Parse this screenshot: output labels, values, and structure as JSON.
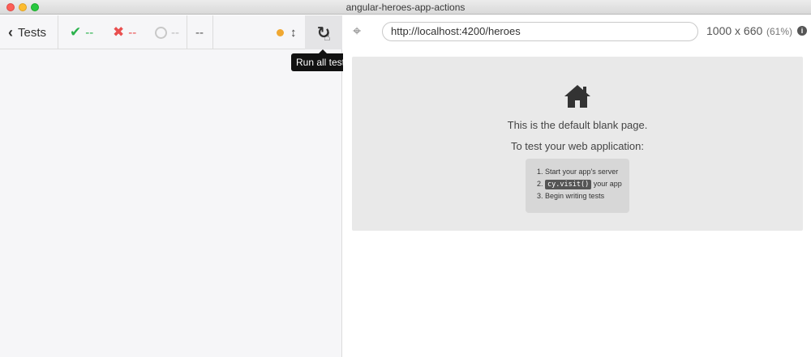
{
  "window": {
    "title": "angular-heroes-app-actions"
  },
  "reporter": {
    "back_label": "Tests",
    "stats": {
      "passed": "--",
      "failed": "--",
      "pending": "--",
      "duration": "--"
    },
    "run_all_tooltip": "Run all tests",
    "status_dot_color": "#f0a832"
  },
  "aut": {
    "url": "http://localhost:4200/heroes",
    "viewport": "1000 x 660",
    "scale": "(61%)",
    "blank_page": {
      "title": "This is the default blank page.",
      "subtitle": "To test your web application:",
      "steps": [
        {
          "num": "1.",
          "text": "Start your app's server"
        },
        {
          "num": "2.",
          "code": "cy.visit()",
          "text": " your app"
        },
        {
          "num": "3.",
          "text": "Begin writing tests"
        }
      ]
    }
  }
}
